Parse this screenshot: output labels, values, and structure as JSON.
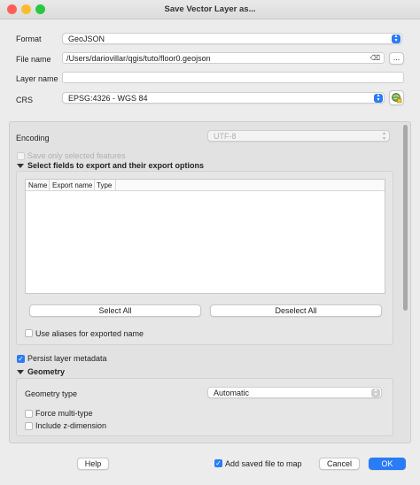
{
  "window": {
    "title": "Save Vector Layer as..."
  },
  "form": {
    "format_label": "Format",
    "format_value": "GeoJSON",
    "filename_label": "File name",
    "filename_value": "/Users/dariovillar/qgis/tuto/floor0.geojson",
    "browse_label": "...",
    "layername_label": "Layer name",
    "layername_value": "",
    "crs_label": "CRS",
    "crs_value": "EPSG:4326 - WGS 84"
  },
  "options": {
    "encoding_label": "Encoding",
    "encoding_value": "UTF-8",
    "save_selected_label": "Save only selected features",
    "fields_group_title": "Select fields to export and their export options",
    "table_headers": [
      "Name",
      "Export name",
      "Type"
    ],
    "select_all_label": "Select All",
    "deselect_all_label": "Deselect All",
    "use_aliases_label": "Use aliases for exported name",
    "persist_metadata_label": "Persist layer metadata",
    "persist_metadata_checked": true,
    "geometry_group_title": "Geometry",
    "geometry_type_label": "Geometry type",
    "geometry_type_value": "Automatic",
    "force_multi_label": "Force multi-type",
    "include_z_label": "Include z-dimension"
  },
  "footer": {
    "help_label": "Help",
    "add_to_map_label": "Add saved file to map",
    "add_to_map_checked": true,
    "cancel_label": "Cancel",
    "ok_label": "OK"
  },
  "colors": {
    "accent": "#2a7bf6",
    "close": "#ff5f57",
    "minimize": "#febc2e",
    "zoom": "#28c840"
  }
}
